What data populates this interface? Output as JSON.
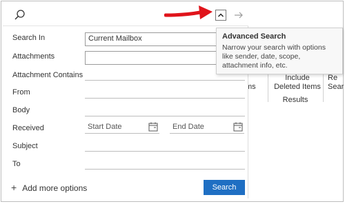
{
  "toolbar": {
    "search_icon": "search-icon",
    "collapse_icon": "chevron-up-icon",
    "forward_icon": "arrow-right-icon"
  },
  "form": {
    "search_in": {
      "label": "Search In",
      "value": "Current Mailbox"
    },
    "attachments": {
      "label": "Attachments",
      "value": ""
    },
    "attachment_contains": {
      "label": "Attachment Contains",
      "value": ""
    },
    "from": {
      "label": "From",
      "value": ""
    },
    "body": {
      "label": "Body",
      "value": ""
    },
    "received": {
      "label": "Received",
      "start_placeholder": "Start Date",
      "end_placeholder": "End Date"
    },
    "subject": {
      "label": "Subject",
      "value": ""
    },
    "to": {
      "label": "To",
      "value": ""
    }
  },
  "footer": {
    "add_more_label": "Add more options",
    "search_button": "Search"
  },
  "tooltip": {
    "title": "Advanced Search",
    "body": "Narrow your search with options like sender, date, scope, attachment info, etc."
  },
  "background": {
    "col1": "ms",
    "col2_line1": "Include",
    "col2_line2": "Deleted Items",
    "col3_line1": "Re",
    "col3_line2": "Sear",
    "results_label": "Results"
  },
  "colors": {
    "accent": "#1f6fc3",
    "annotation_arrow": "#e0141b"
  }
}
